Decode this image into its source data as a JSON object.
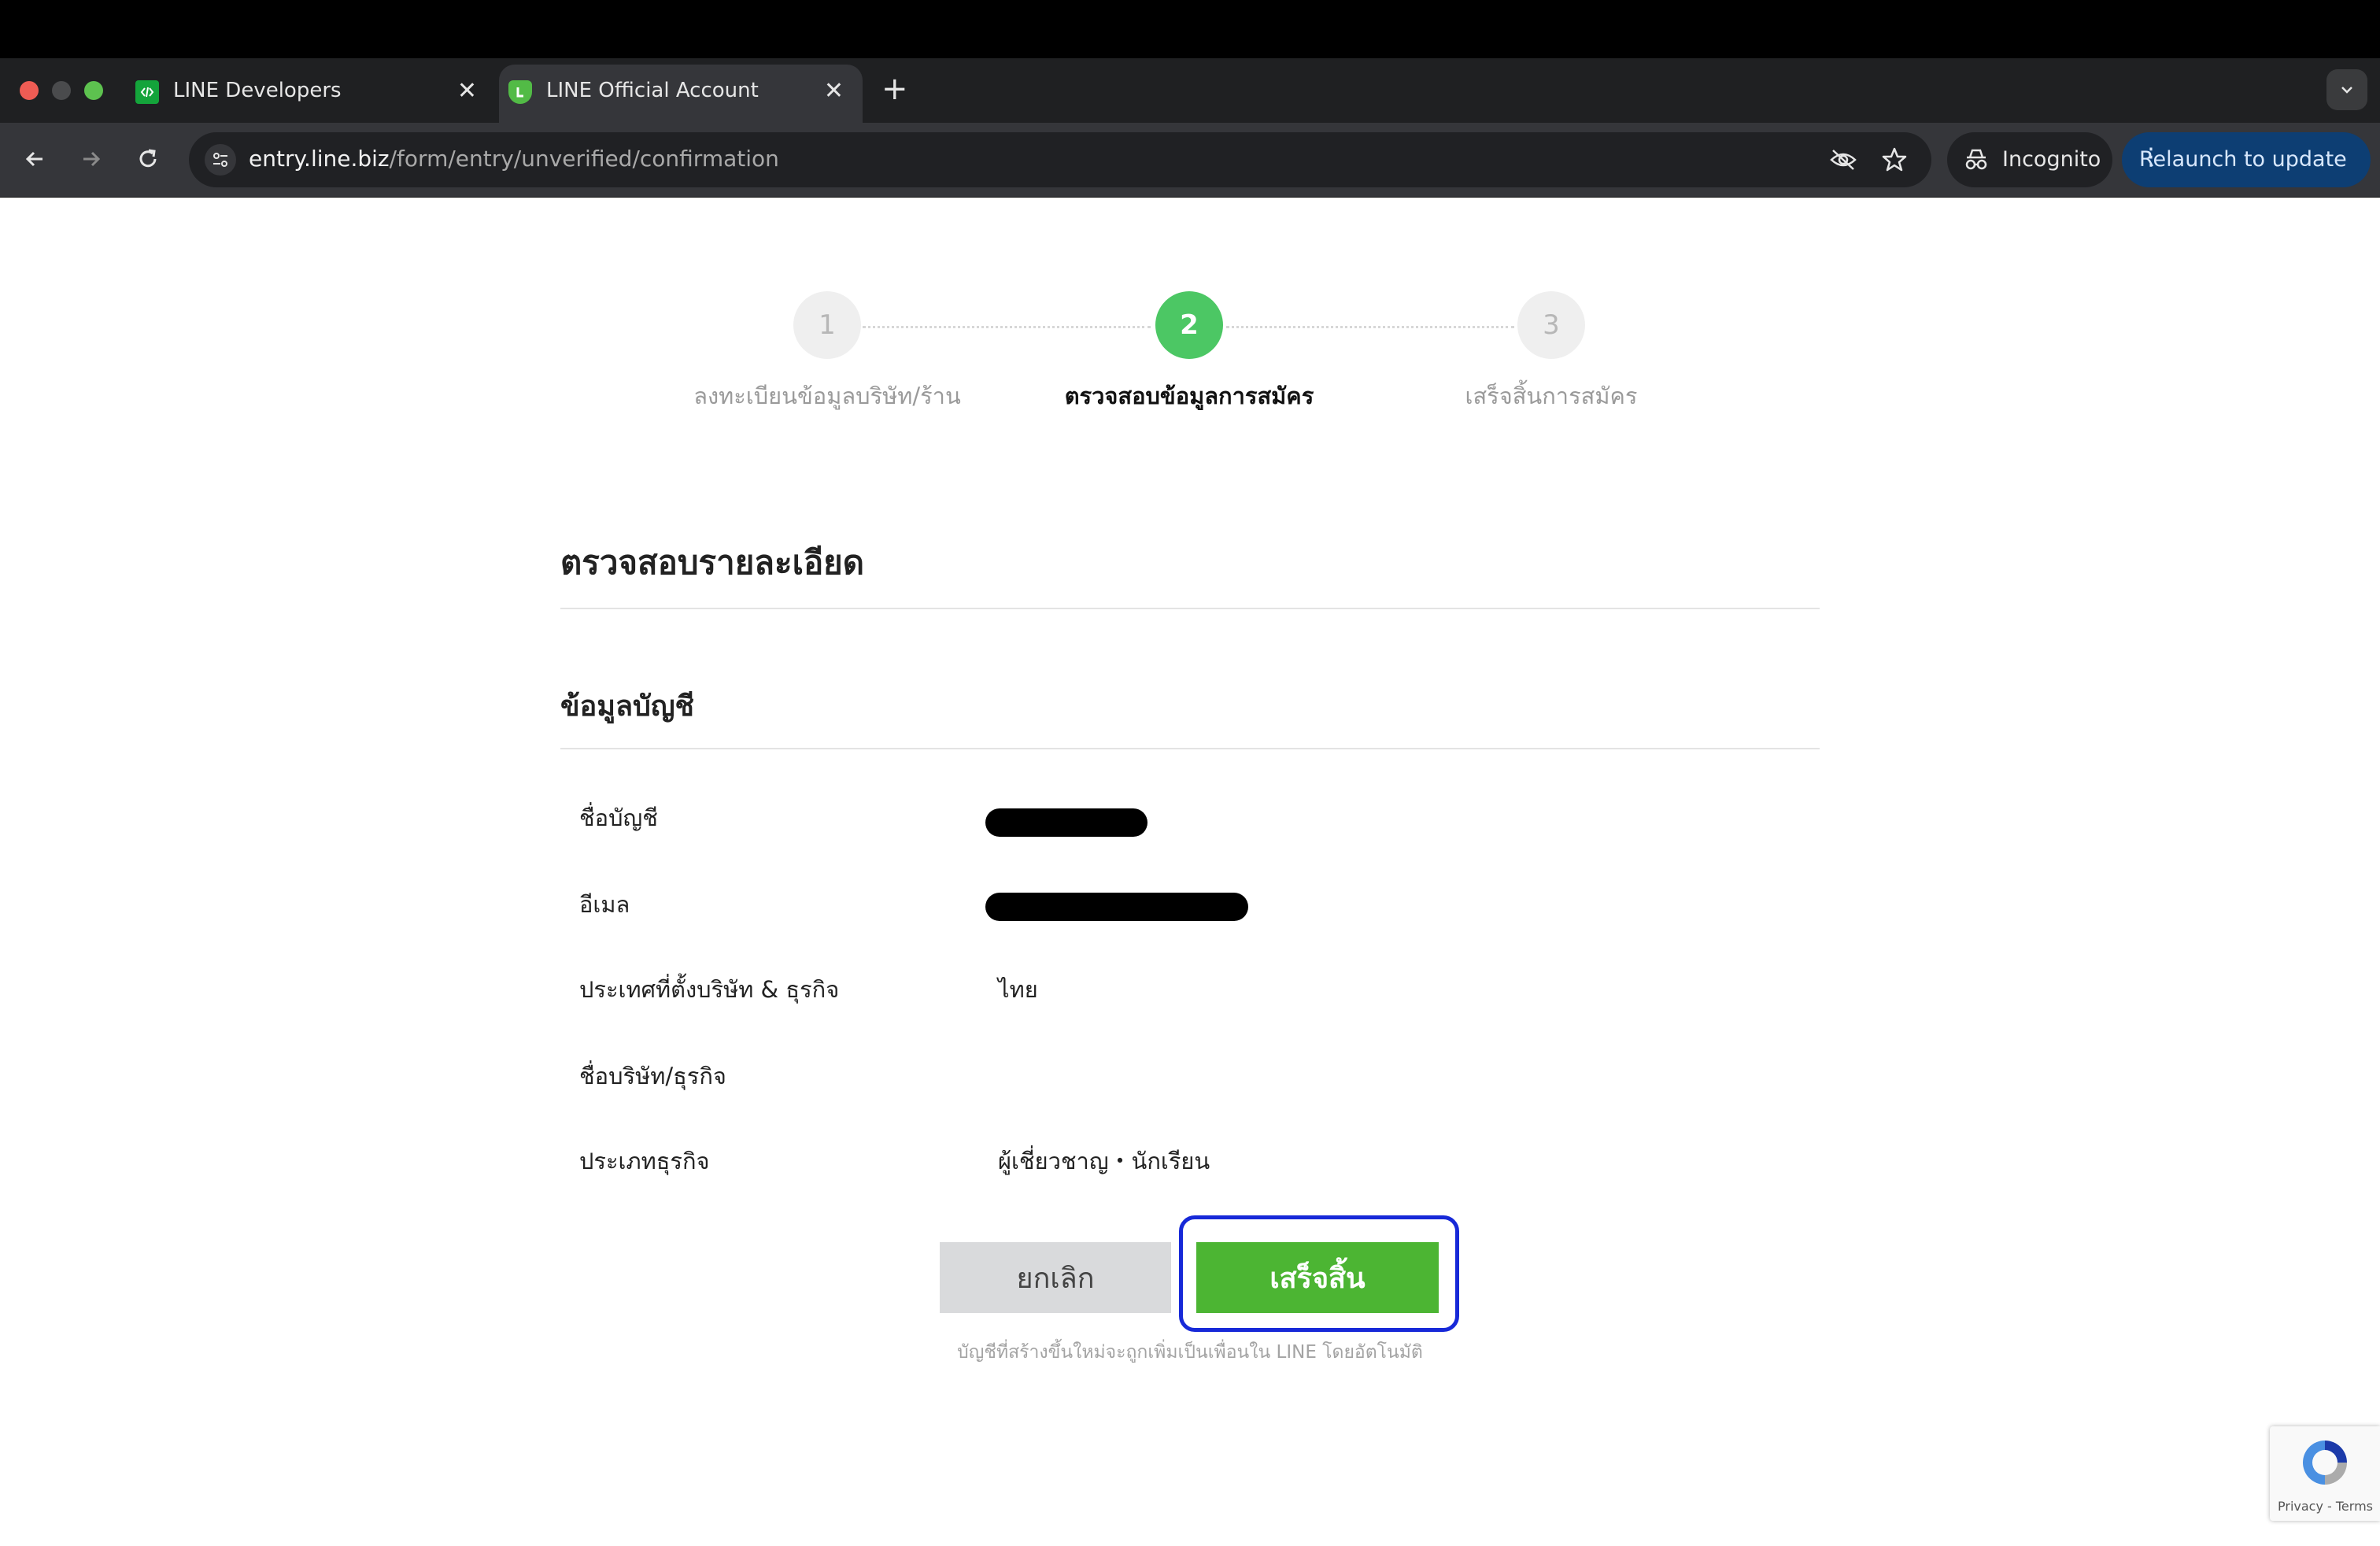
{
  "browser": {
    "tabs": [
      {
        "title": "LINE Developers",
        "icon": "line-developers-icon"
      },
      {
        "title": "LINE Official Account",
        "icon": "line-shield-icon"
      }
    ],
    "new_tab_label": "+",
    "close_label": "✕",
    "url_host": "entry.line.biz",
    "url_path": "/form/entry/unverified/confirmation",
    "incognito_label": "Incognito",
    "relaunch_label": "Relaunch to update",
    "relaunch_menu": "⋮"
  },
  "steps": [
    {
      "number": "1",
      "label": "ลงทะเบียนข้อมูลบริษัท/ร้าน",
      "state": "done"
    },
    {
      "number": "2",
      "label": "ตรวจสอบข้อมูลการสมัคร",
      "state": "current"
    },
    {
      "number": "3",
      "label": "เสร็จสิ้นการสมัคร",
      "state": "todo"
    }
  ],
  "page": {
    "title": "ตรวจสอบรายละเอียด",
    "section_title": "ข้อมูลบัญชี"
  },
  "fields": [
    {
      "label": "ชื่อบัญชี",
      "value": ""
    },
    {
      "label": "อีเมล",
      "value": ""
    },
    {
      "label": "ประเทศที่ตั้งบริษัท & ธุรกิจ",
      "value": "ไทย"
    },
    {
      "label": "ชื่อบริษัท/ธุรกิจ",
      "value": ""
    },
    {
      "label": "ประเภทธุรกิจ",
      "value": "ผู้เชี่ยวชาญ・นักเรียน"
    }
  ],
  "actions": {
    "cancel_label": "ยกเลิก",
    "finish_label": "เสร็จสิ้น",
    "footnote": "บัญชีที่สร้างขึ้นใหม่จะถูกเพิ่มเป็นเพื่อนใน LINE โดยอัตโนมัติ"
  },
  "recaptcha": {
    "links": "Privacy - Terms"
  },
  "colors": {
    "line_green": "#4cc764",
    "button_green": "#4cb533",
    "highlight_blue": "#1729d8"
  }
}
